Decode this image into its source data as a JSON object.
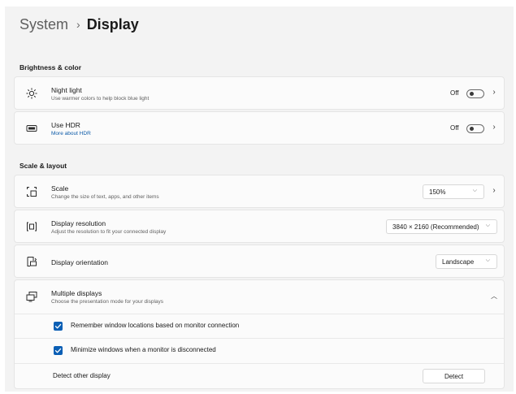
{
  "breadcrumb": {
    "parent": "System",
    "separator": "›",
    "current": "Display"
  },
  "sections": {
    "brightness": "Brightness & color",
    "scale_layout": "Scale & layout"
  },
  "night_light": {
    "title": "Night light",
    "desc": "Use warmer colors to help block blue light",
    "state_label": "Off",
    "on": false,
    "icon": "sun-icon"
  },
  "hdr": {
    "title": "Use HDR",
    "link": "More about HDR",
    "state_label": "Off",
    "on": false,
    "icon": "hdr-icon"
  },
  "scale": {
    "title": "Scale",
    "desc": "Change the size of text, apps, and other items",
    "value": "150%",
    "icon": "scale-icon"
  },
  "resolution": {
    "title": "Display resolution",
    "desc": "Adjust the resolution to fit your connected display",
    "value": "3840 × 2160 (Recommended)",
    "icon": "resolution-icon"
  },
  "orientation": {
    "title": "Display orientation",
    "value": "Landscape",
    "icon": "orientation-icon"
  },
  "multiple_displays": {
    "title": "Multiple displays",
    "desc": "Choose the presentation mode for your displays",
    "expanded": true,
    "icon": "multiple-displays-icon",
    "options": [
      {
        "label": "Remember window locations based on monitor connection",
        "checked": true
      },
      {
        "label": "Minimize windows when a monitor is disconnected",
        "checked": true
      }
    ],
    "detect_label": "Detect other display",
    "detect_button": "Detect"
  },
  "colors": {
    "accent": "#0b5fb5",
    "link": "#0b5aa8",
    "background": "#f3f3f3",
    "card": "#fbfbfb"
  }
}
